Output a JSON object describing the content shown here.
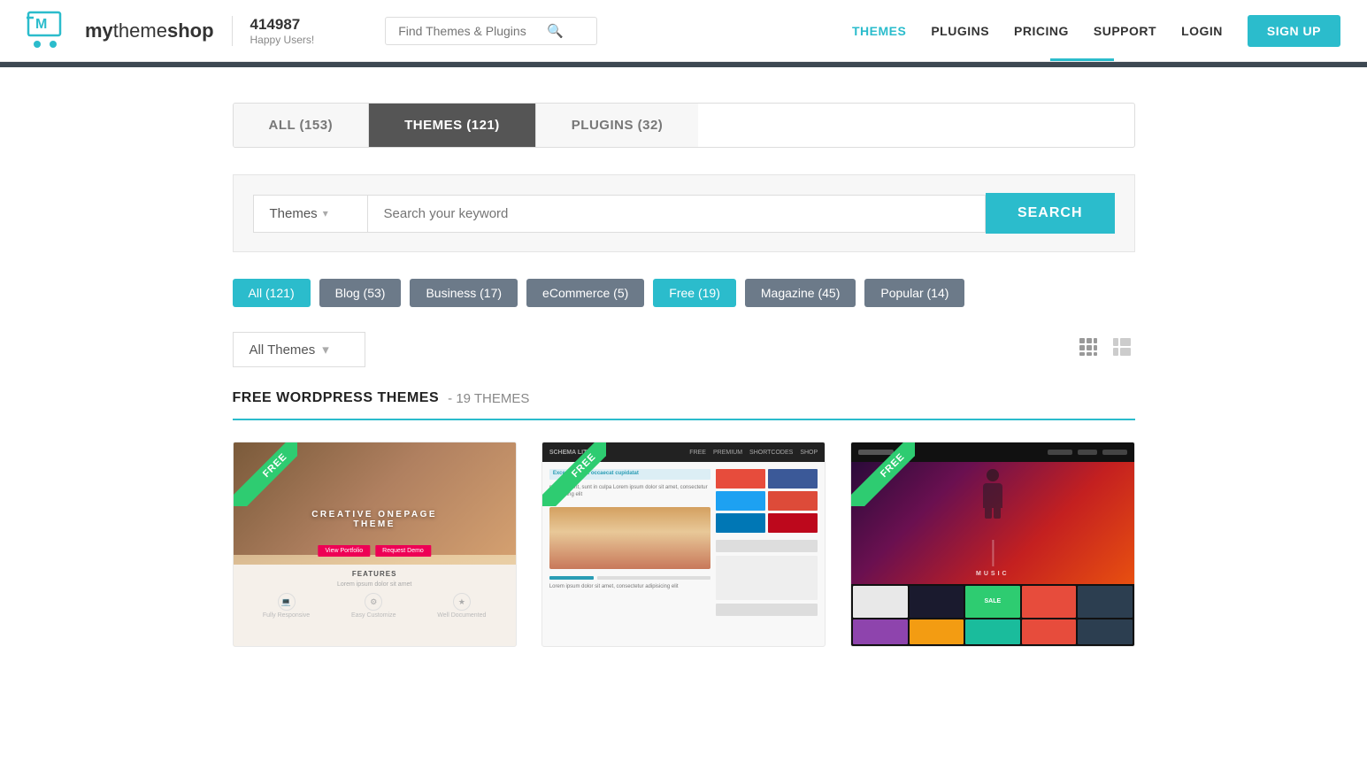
{
  "header": {
    "logo_text_prefix": "my",
    "logo_text_brand": "theme",
    "logo_text_suffix": "shop",
    "user_count": "414987",
    "user_label": "Happy Users!",
    "search_placeholder": "Find Themes & Plugins",
    "nav": [
      {
        "label": "THEMES",
        "active": true
      },
      {
        "label": "PLUGINS",
        "active": false
      },
      {
        "label": "PRICING",
        "active": false
      },
      {
        "label": "SUPPORT",
        "active": false
      },
      {
        "label": "LOGIN",
        "active": false
      }
    ],
    "signup_label": "SIGN UP"
  },
  "tabs": [
    {
      "label": "ALL (153)",
      "active": false
    },
    {
      "label": "THEMES (121)",
      "active": true
    },
    {
      "label": "PLUGINS (32)",
      "active": false
    }
  ],
  "search": {
    "dropdown_label": "Themes",
    "keyword_placeholder": "Search your keyword",
    "button_label": "SEARCH"
  },
  "filter_tags": [
    {
      "label": "All (121)",
      "active": true
    },
    {
      "label": "Blog (53)",
      "active": false
    },
    {
      "label": "Business (17)",
      "active": false
    },
    {
      "label": "eCommerce (5)",
      "active": false
    },
    {
      "label": "Free (19)",
      "active": false
    },
    {
      "label": "Magazine (45)",
      "active": false
    },
    {
      "label": "Popular (14)",
      "active": false
    }
  ],
  "sort": {
    "dropdown_label": "All Themes"
  },
  "section": {
    "title": "FREE WORDPRESS THEMES",
    "separator": " - ",
    "count": "19 THEMES"
  },
  "themes": [
    {
      "badge": "FREE",
      "overlay_text": "CREATIVE ONEPAGE THEME",
      "type": "onepage"
    },
    {
      "badge": "FREE",
      "type": "blog"
    },
    {
      "badge": "FREE",
      "type": "music"
    }
  ],
  "colors": {
    "accent": "#2bbccc",
    "dark_strip": "#3d4852",
    "tag_default": "#6c7a89",
    "free_badge": "#2ecc71"
  }
}
